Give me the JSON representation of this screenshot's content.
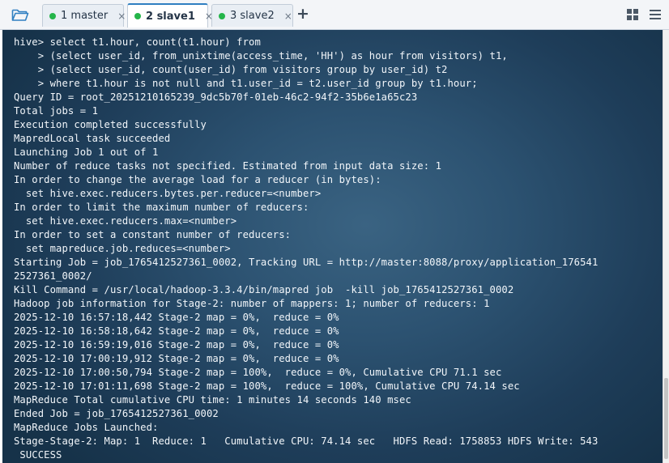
{
  "tabs": [
    {
      "number": "1",
      "label": "1 master",
      "active": false
    },
    {
      "number": "2",
      "label": "2 slave1",
      "active": true
    },
    {
      "number": "3",
      "label": "3 slave2",
      "active": false
    }
  ],
  "tab_close_glyph": "×",
  "add_tab_glyph": "+",
  "icons": {
    "open_folder": "folder-open-icon",
    "grid_layout": "grid-layout-icon",
    "menu": "hamburger-menu-icon"
  },
  "colors": {
    "status_dot": "#25b54a",
    "active_tab_accent": "#2f7fc1",
    "terminal_bg": "#2c5271",
    "terminal_text": "#f2f6fa"
  },
  "terminal": {
    "lines": [
      "hive> select t1.hour, count(t1.hour) from",
      "    > (select user_id, from_unixtime(access_time, 'HH') as hour from visitors) t1,",
      "    > (select user_id, count(user_id) from visitors group by user_id) t2",
      "    > where t1.hour is not null and t1.user_id = t2.user_id group by t1.hour;",
      "Query ID = root_20251210165239_9dc5b70f-01eb-46c2-94f2-35b6e1a65c23",
      "Total jobs = 1",
      "Execution completed successfully",
      "MapredLocal task succeeded",
      "Launching Job 1 out of 1",
      "Number of reduce tasks not specified. Estimated from input data size: 1",
      "In order to change the average load for a reducer (in bytes):",
      "  set hive.exec.reducers.bytes.per.reducer=<number>",
      "In order to limit the maximum number of reducers:",
      "  set hive.exec.reducers.max=<number>",
      "In order to set a constant number of reducers:",
      "  set mapreduce.job.reduces=<number>",
      "Starting Job = job_1765412527361_0002, Tracking URL = http://master:8088/proxy/application_176541",
      "2527361_0002/",
      "Kill Command = /usr/local/hadoop-3.3.4/bin/mapred job  -kill job_1765412527361_0002",
      "Hadoop job information for Stage-2: number of mappers: 1; number of reducers: 1",
      "2025-12-10 16:57:18,442 Stage-2 map = 0%,  reduce = 0%",
      "2025-12-10 16:58:18,642 Stage-2 map = 0%,  reduce = 0%",
      "2025-12-10 16:59:19,016 Stage-2 map = 0%,  reduce = 0%",
      "2025-12-10 17:00:19,912 Stage-2 map = 0%,  reduce = 0%",
      "2025-12-10 17:00:50,794 Stage-2 map = 100%,  reduce = 0%, Cumulative CPU 71.1 sec",
      "2025-12-10 17:01:11,698 Stage-2 map = 100%,  reduce = 100%, Cumulative CPU 74.14 sec",
      "MapReduce Total cumulative CPU time: 1 minutes 14 seconds 140 msec",
      "Ended Job = job_1765412527361_0002",
      "MapReduce Jobs Launched:",
      "Stage-Stage-2: Map: 1  Reduce: 1   Cumulative CPU: 74.14 sec   HDFS Read: 1758853 HDFS Write: 543",
      " SUCCESS"
    ]
  }
}
